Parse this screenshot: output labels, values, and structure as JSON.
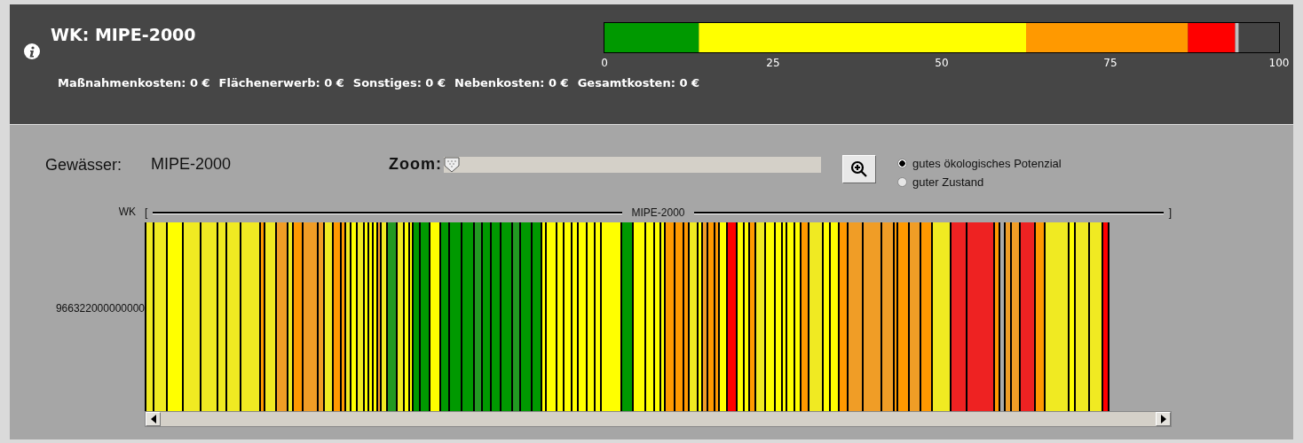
{
  "header": {
    "title": "WK: MIPE-2000",
    "costs": [
      {
        "label": "Maßnahmenkosten:",
        "value": "0 €"
      },
      {
        "label": "Flächenerwerb:",
        "value": "0 €"
      },
      {
        "label": "Sonstiges:",
        "value": "0 €"
      },
      {
        "label": "Nebenkosten:",
        "value": "0 €"
      },
      {
        "label": "Gesamtkosten:",
        "value": "0 €"
      }
    ],
    "chart_data": {
      "type": "bar",
      "stacked": true,
      "orientation": "horizontal",
      "xlim": [
        0,
        100
      ],
      "xticks": [
        0,
        25,
        50,
        75,
        100
      ],
      "series": [
        {
          "color": "#009900",
          "values": [
            14
          ]
        },
        {
          "color": "#ffff00",
          "values": [
            48.5
          ]
        },
        {
          "color": "#ff9900",
          "values": [
            24
          ]
        },
        {
          "color": "#ff0000",
          "values": [
            7
          ]
        },
        {
          "color": "#c0c0c0",
          "values": [
            0.5
          ]
        }
      ]
    }
  },
  "water_body": {
    "label": "Gewässer:",
    "value": "MIPE-2000"
  },
  "zoom": {
    "label": "Zoom:",
    "level": 0
  },
  "target_options": [
    {
      "label": "gutes ökologisches Potenzial",
      "selected": true
    },
    {
      "label": "guter Zustand",
      "selected": false
    }
  ],
  "strip_chart": {
    "row_label": "WK",
    "range_open": "[",
    "range_label": "MIPE-2000",
    "range_close": "]",
    "segment_row_label": "966322000000000"
  }
}
